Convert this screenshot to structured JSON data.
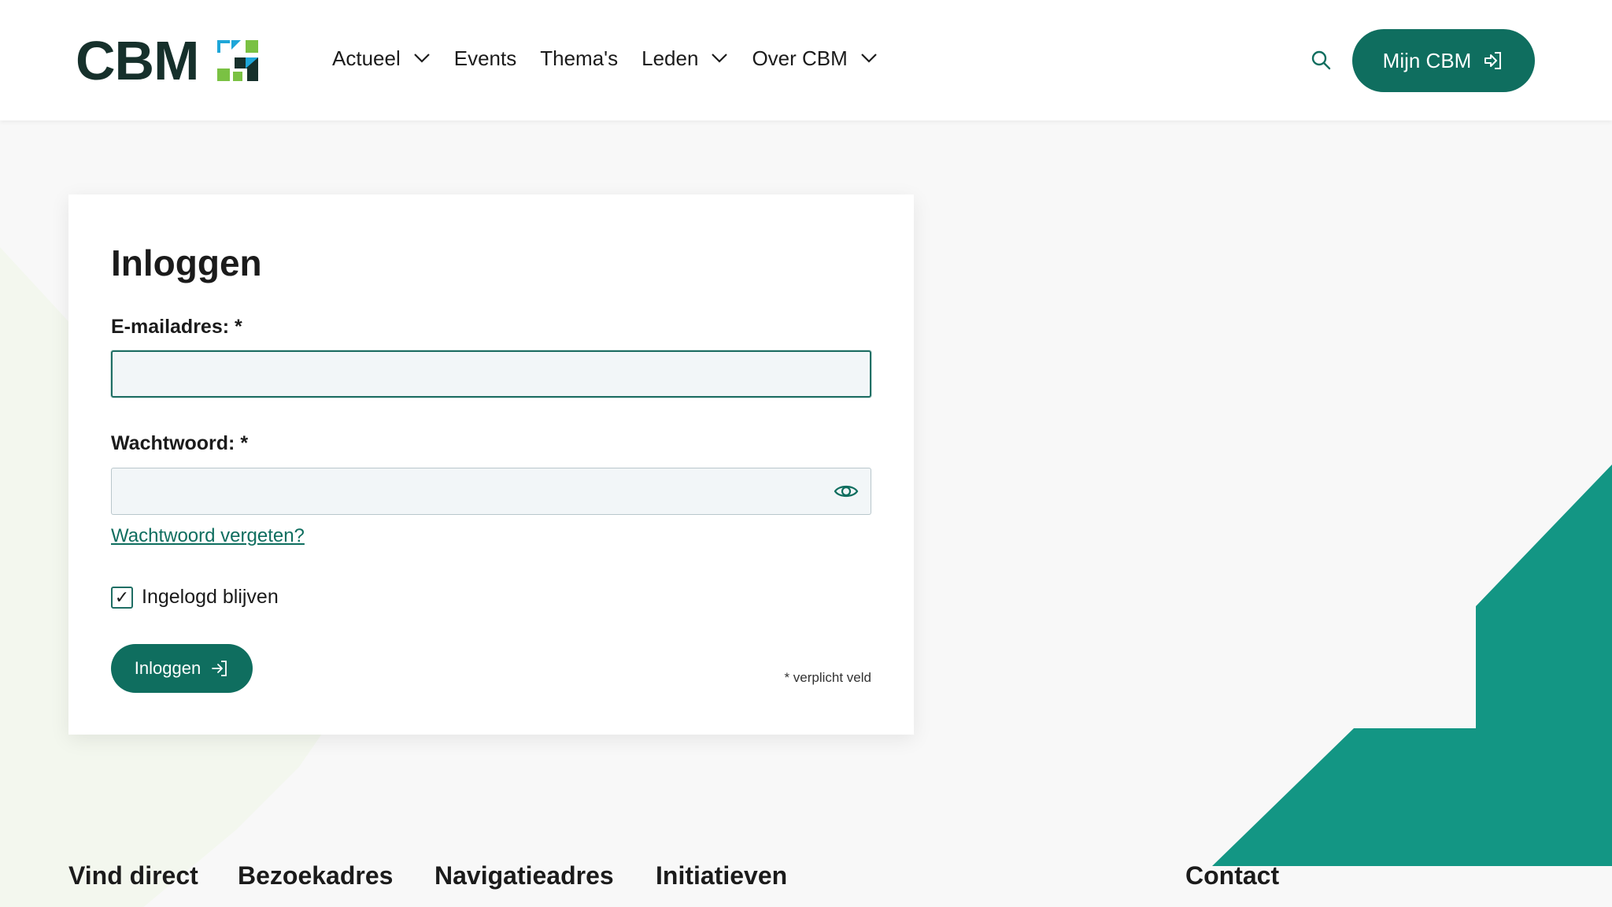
{
  "header": {
    "logo_text": "CBM",
    "nav": [
      {
        "label": "Actueel",
        "has_dropdown": true
      },
      {
        "label": "Events",
        "has_dropdown": false
      },
      {
        "label": "Thema's",
        "has_dropdown": false
      },
      {
        "label": "Leden",
        "has_dropdown": true
      },
      {
        "label": "Over CBM",
        "has_dropdown": true
      }
    ],
    "search_icon": "search-icon",
    "account_button": {
      "label": "Mijn CBM",
      "icon": "sign-in-icon"
    }
  },
  "login": {
    "title": "Inloggen",
    "email_label": "E-mailadres: *",
    "email_value": "",
    "password_label": "Wachtwoord: *",
    "password_value": "",
    "show_password_icon": "eye-icon",
    "forgot_link": "Wachtwoord vergeten?",
    "remember_label": "Ingelogd blijven",
    "remember_checked": true,
    "submit_label": "Inloggen",
    "required_note": "* verplicht veld"
  },
  "footer": {
    "headings": [
      "Vind direct",
      "Bezoekadres",
      "Navigatieadres",
      "Initiatieven",
      "Contact"
    ]
  },
  "colors": {
    "brand_teal": "#0f6e5f",
    "accent_teal": "#139684",
    "logo_green": "#7ac143",
    "logo_blue": "#1ea6d8"
  }
}
